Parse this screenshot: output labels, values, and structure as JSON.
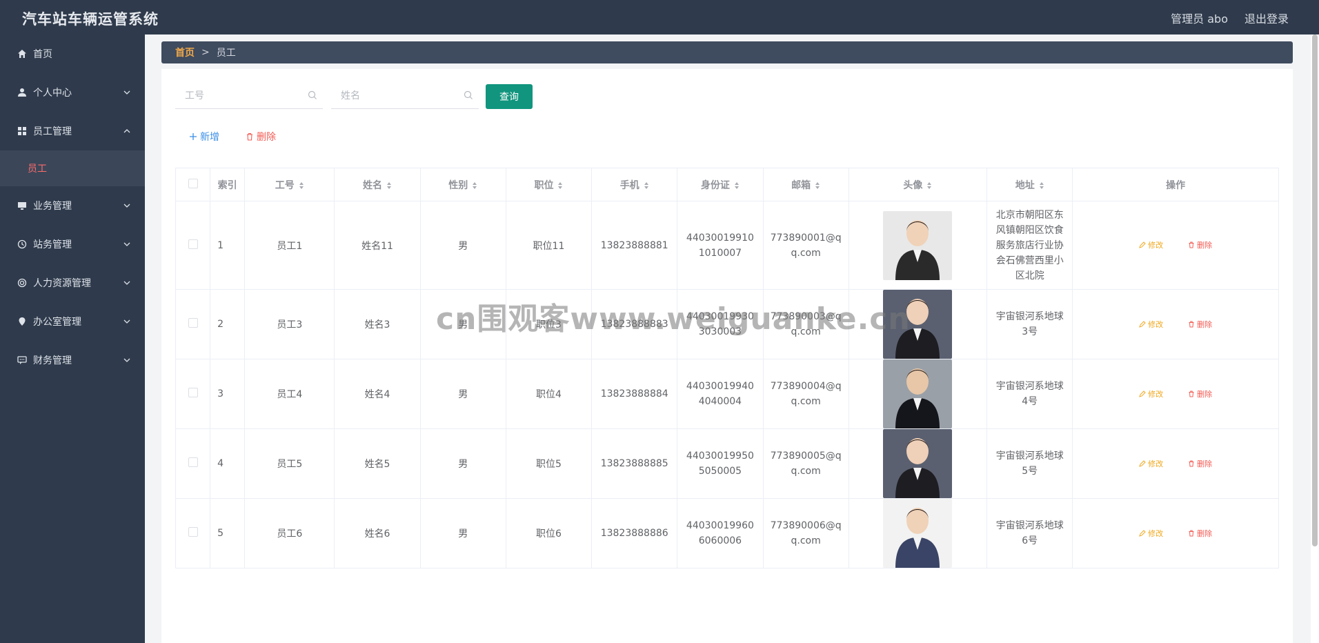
{
  "header": {
    "title": "汽车站车辆运管系统",
    "user_label": "管理员 abo",
    "logout_label": "退出登录"
  },
  "sidebar": {
    "items": [
      {
        "label": "首页",
        "icon": "home-icon",
        "expandable": false
      },
      {
        "label": "个人中心",
        "icon": "user-icon",
        "expandable": true
      },
      {
        "label": "员工管理",
        "icon": "grid-icon",
        "expandable": true,
        "expanded": true
      },
      {
        "label": "业务管理",
        "icon": "monitor-icon",
        "expandable": true
      },
      {
        "label": "站务管理",
        "icon": "clock-icon",
        "expandable": true
      },
      {
        "label": "人力资源管理",
        "icon": "target-icon",
        "expandable": true
      },
      {
        "label": "办公室管理",
        "icon": "location-icon",
        "expandable": true
      },
      {
        "label": "财务管理",
        "icon": "chat-icon",
        "expandable": true
      }
    ],
    "sub_item": "员工"
  },
  "breadcrumb": {
    "home": "首页",
    "separator": ">",
    "current": "员工"
  },
  "search": {
    "id_placeholder": "工号",
    "name_placeholder": "姓名",
    "query_label": "查询"
  },
  "actions": {
    "add_label": "新增",
    "delete_label": "删除"
  },
  "table": {
    "columns": [
      "索引",
      "工号",
      "姓名",
      "性别",
      "职位",
      "手机",
      "身份证",
      "邮箱",
      "头像",
      "地址",
      "操作"
    ],
    "edit_label": "修改",
    "delete_label": "删除",
    "rows": [
      {
        "index": "1",
        "id": "员工1",
        "name": "姓名11",
        "gender": "男",
        "position": "职位11",
        "phone": "13823888881",
        "idcard": "440300199101010007",
        "email": "773890001@qq.com",
        "address": "北京市朝阳区东风镇朝阳区饮食服务旅店行业协会石佛营西里小区北院"
      },
      {
        "index": "2",
        "id": "员工3",
        "name": "姓名3",
        "gender": "男",
        "position": "职位3",
        "phone": "13823888883",
        "idcard": "440300199303030003",
        "email": "773890003@qq.com",
        "address": "宇宙银河系地球3号"
      },
      {
        "index": "3",
        "id": "员工4",
        "name": "姓名4",
        "gender": "男",
        "position": "职位4",
        "phone": "13823888884",
        "idcard": "440300199404040004",
        "email": "773890004@qq.com",
        "address": "宇宙银河系地球4号"
      },
      {
        "index": "4",
        "id": "员工5",
        "name": "姓名5",
        "gender": "男",
        "position": "职位5",
        "phone": "13823888885",
        "idcard": "440300199505050005",
        "email": "773890005@qq.com",
        "address": "宇宙银河系地球5号"
      },
      {
        "index": "5",
        "id": "员工6",
        "name": "姓名6",
        "gender": "男",
        "position": "职位6",
        "phone": "13823888886",
        "idcard": "440300199606060006",
        "email": "773890006@qq.com",
        "address": "宇宙银河系地球6号"
      }
    ]
  },
  "watermark": "cn围观客www.weiguanke.cn",
  "colors": {
    "sidebar": "#2f3b4c",
    "accent": "#11957e",
    "active_sub": "#ff6b6b",
    "edit": "#f0a81e",
    "danger": "#f25c54"
  }
}
